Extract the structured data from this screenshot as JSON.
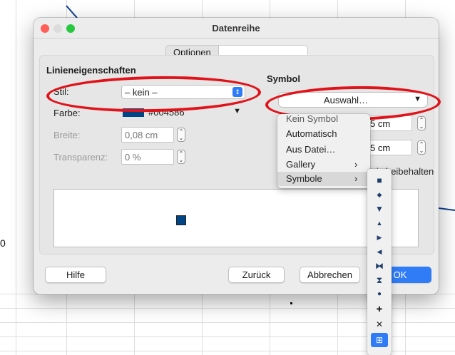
{
  "dialog": {
    "title": "Datenreihe",
    "tabs": [
      {
        "label": "Optionen"
      },
      {
        "label": ""
      }
    ]
  },
  "line_props": {
    "heading": "Linieneigenschaften",
    "style_label": "Stil:",
    "style_value": "– kein –",
    "color_label": "Farbe:",
    "color_value": "#004586",
    "color_hex": "#004586",
    "width_label": "Breite:",
    "width_value": "0,08 cm",
    "transparency_label": "Transparenz:",
    "transparency_value": "0 %"
  },
  "symbol": {
    "heading": "Symbol",
    "select_label": "Auswahl…",
    "width_value": "5 cm",
    "height_value": "5 cm",
    "keep_ratio_label": "ältnis beibehalten"
  },
  "symbol_menu": {
    "items": [
      {
        "label": "Kein Symbol",
        "has_sub": false
      },
      {
        "label": "Automatisch",
        "has_sub": false
      },
      {
        "label": "Aus Datei…",
        "has_sub": false
      },
      {
        "label": "Gallery",
        "has_sub": true
      },
      {
        "label": "Symbole",
        "has_sub": true
      }
    ],
    "submenu_arrow": "›"
  },
  "symbol_shapes": [
    {
      "name": "square",
      "glyph": "■"
    },
    {
      "name": "diamond",
      "glyph": "◆"
    },
    {
      "name": "triangle-down",
      "glyph": "▼"
    },
    {
      "name": "triangle-up",
      "glyph": "▲"
    },
    {
      "name": "triangle-right",
      "glyph": "▶"
    },
    {
      "name": "triangle-left",
      "glyph": "◀"
    },
    {
      "name": "bowtie",
      "glyph": "⧓"
    },
    {
      "name": "hourglass",
      "glyph": "⧗"
    },
    {
      "name": "circle",
      "glyph": "●"
    },
    {
      "name": "plus",
      "glyph": "✚"
    },
    {
      "name": "cross",
      "glyph": "✕"
    },
    {
      "name": "square-plus",
      "glyph": "⊞"
    }
  ],
  "buttons": {
    "help": "Hilfe",
    "back": "Zurück",
    "cancel": "Abbrechen",
    "ok": "OK"
  },
  "background": {
    "axis_label": "0"
  },
  "colors": {
    "accent": "#2f7cf6",
    "highlight": "#e1131a",
    "series": "#004586"
  }
}
